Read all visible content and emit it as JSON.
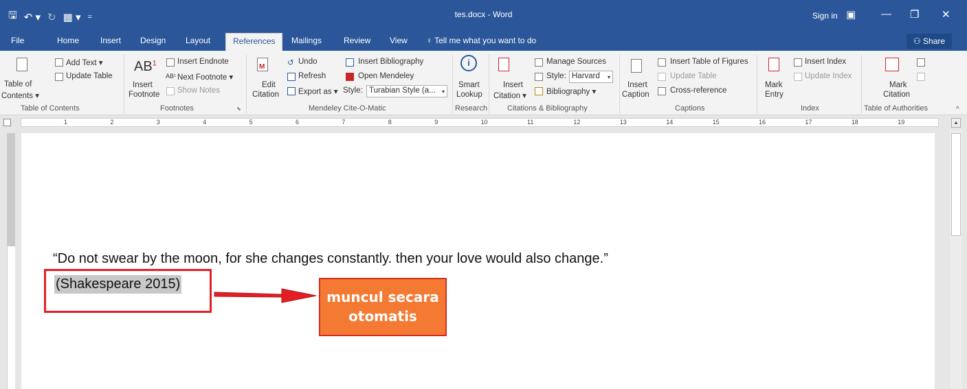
{
  "titlebar": {
    "title": "tes.docx - Word",
    "sign_in": "Sign in",
    "bg_color": "#2b579a"
  },
  "quick_access": {
    "save_icon": "save-icon",
    "undo_icon": "undo-icon",
    "redo_icon": "redo-icon",
    "customize_icon": "customize-icon"
  },
  "tabs": [
    {
      "label": "File"
    },
    {
      "label": "Home"
    },
    {
      "label": "Insert"
    },
    {
      "label": "Design"
    },
    {
      "label": "Layout"
    },
    {
      "label": "References"
    },
    {
      "label": "Mailings"
    },
    {
      "label": "Review"
    },
    {
      "label": "View"
    }
  ],
  "tell_me": "Tell me what you want to do",
  "share": "Share",
  "ribbon": {
    "toc": {
      "table_of": "Table of",
      "contents": "Contents ▾",
      "add_text": "Add Text ▾",
      "update_table": "Update Table",
      "group": "Table of Contents"
    },
    "footnotes": {
      "insert": "Insert",
      "footnote": "Footnote",
      "insert_endnote": "Insert Endnote",
      "next_footnote": "Next Footnote ▾",
      "show_notes": "Show Notes",
      "group": "Footnotes"
    },
    "mendeley": {
      "edit": "Edit",
      "citation": "Citation",
      "undo": "Undo",
      "refresh": "Refresh",
      "export_as": "Export as ▾",
      "insert_bibliography": "Insert Bibliography",
      "open_mendeley": "Open Mendeley",
      "style_label": "Style:",
      "style_value": "Turabian Style (a...",
      "group": "Mendeley Cite-O-Matic"
    },
    "research": {
      "smart": "Smart",
      "lookup": "Lookup",
      "group": "Research"
    },
    "citations": {
      "insert": "Insert",
      "citation": "Citation ▾",
      "manage_sources": "Manage Sources",
      "style_label": "Style:",
      "style_value": "Harvard",
      "bibliography": "Bibliography ▾",
      "group": "Citations & Bibliography"
    },
    "captions": {
      "insert": "Insert",
      "caption": "Caption",
      "insert_table_of_figures": "Insert Table of Figures",
      "update_table": "Update Table",
      "cross_reference": "Cross-reference",
      "group": "Captions"
    },
    "index": {
      "mark": "Mark",
      "entry": "Entry",
      "insert_index": "Insert Index",
      "update_index": "Update Index",
      "group": "Index"
    },
    "authorities": {
      "mark": "Mark",
      "citation": "Citation",
      "group": "Table of Authorities"
    }
  },
  "ruler": {
    "numbers": [
      "1",
      "2",
      "3",
      "4",
      "5",
      "6",
      "7",
      "8",
      "9",
      "10",
      "11",
      "12",
      "13",
      "14",
      "15",
      "16",
      "17",
      "18",
      "19"
    ]
  },
  "document": {
    "quote": "“Do not swear by the moon, for she changes constantly. then your love would also change.”",
    "citation": "(Shakespeare 2015)"
  },
  "annotation": {
    "callout_line1": "muncul secara",
    "callout_line2": "otomatis",
    "callout_color": "#f47a33",
    "highlight_color": "#e31e24"
  }
}
